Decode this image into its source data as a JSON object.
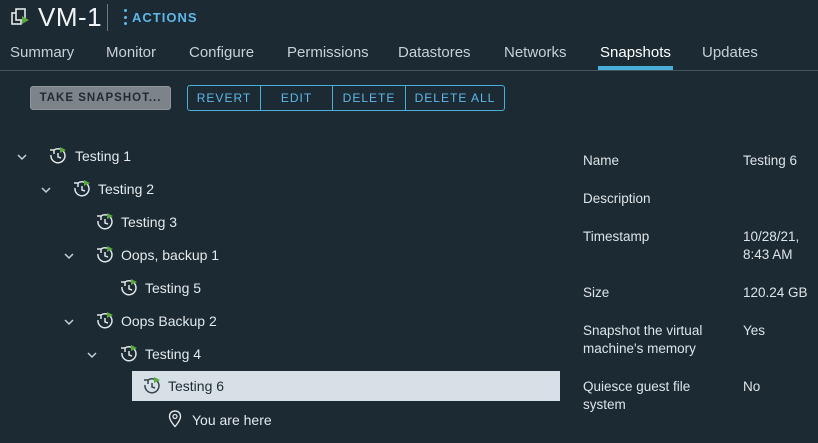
{
  "header": {
    "title": "VM-1",
    "actions_label": "ACTIONS"
  },
  "tabs": [
    {
      "label": "Summary"
    },
    {
      "label": "Monitor"
    },
    {
      "label": "Configure"
    },
    {
      "label": "Permissions"
    },
    {
      "label": "Datastores"
    },
    {
      "label": "Networks"
    },
    {
      "label": "Snapshots",
      "active": true
    },
    {
      "label": "Updates"
    }
  ],
  "toolbar": {
    "take_snapshot": "TAKE SNAPSHOT...",
    "revert": "REVERT",
    "edit": "EDIT",
    "delete": "DELETE",
    "delete_all": "DELETE ALL"
  },
  "tree": {
    "items": [
      {
        "label": "Testing 1",
        "expanded": true
      },
      {
        "label": "Testing 2",
        "expanded": true
      },
      {
        "label": "Testing 3"
      },
      {
        "label": "Oops, backup 1",
        "expanded": true
      },
      {
        "label": "Testing 5"
      },
      {
        "label": "Oops Backup 2",
        "expanded": true
      },
      {
        "label": "Testing 4",
        "expanded": true
      },
      {
        "label": "Testing 6",
        "selected": true
      }
    ],
    "you_are_here": "You are here"
  },
  "details": {
    "name_label": "Name",
    "name_value": "Testing 6",
    "description_label": "Description",
    "timestamp_label": "Timestamp",
    "timestamp_line1": "10/28/21,",
    "timestamp_line2": "8:43 AM",
    "size_label": "Size",
    "size_value": "120.24 GB",
    "memory_label_line1": "Snapshot the virtual",
    "memory_label_line2": "machine's memory",
    "memory_value": "Yes",
    "quiesce_label_line1": "Quiesce guest file",
    "quiesce_label_line2": "system",
    "quiesce_value": "No"
  },
  "colors": {
    "background": "#1b2a33",
    "accent": "#49afd9",
    "selected_row": "#d7e0e6",
    "snapshot_flag": "#5aaa3a"
  }
}
